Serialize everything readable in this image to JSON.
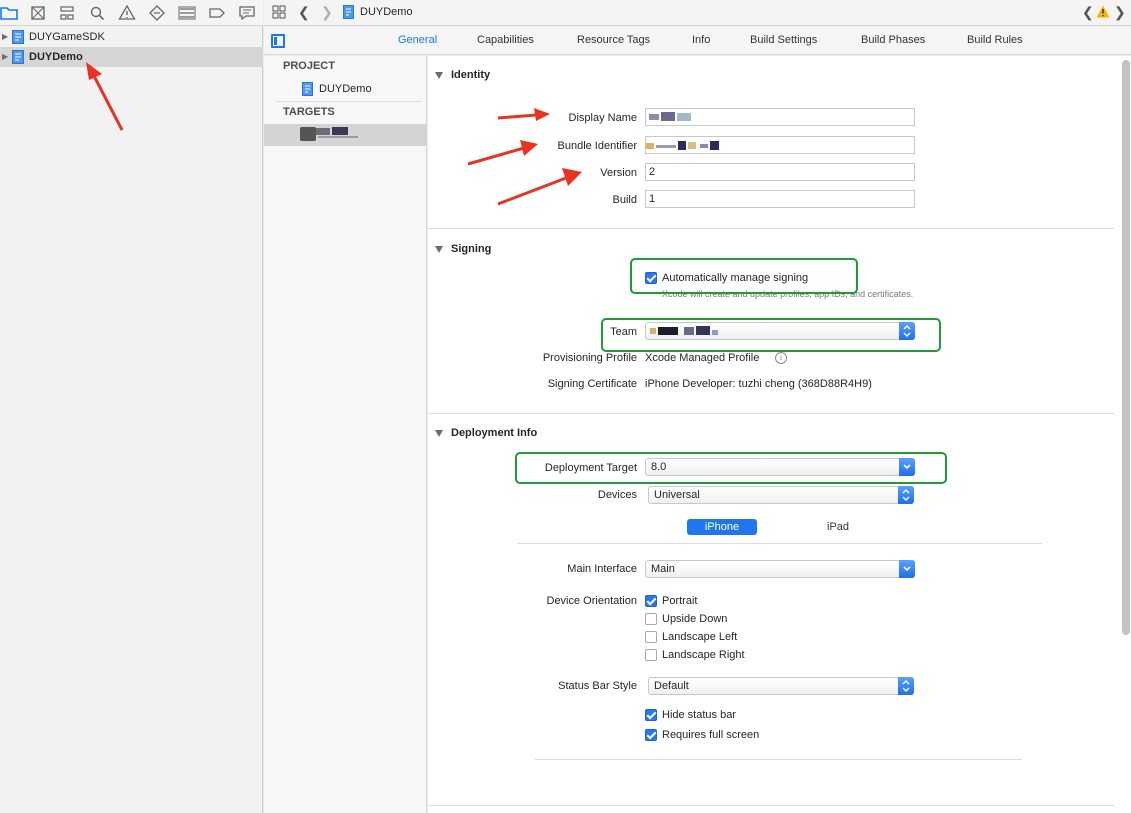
{
  "colors": {
    "accent": "#1c76f0",
    "highlight_box": "#1f9b3a",
    "annotation_arrow": "#e83323"
  },
  "navigator": {
    "toolbar_icons": [
      "folder-icon",
      "source-control-icon",
      "hierarchy-icon",
      "search-icon",
      "warning-icon",
      "test-icon",
      "debug-icon",
      "breakpoint-icon",
      "report-icon"
    ],
    "items": [
      {
        "label": "DUYGameSDK",
        "selected": false
      },
      {
        "label": "DUYDemo",
        "selected": true
      }
    ]
  },
  "jumpbar": {
    "breadcrumb": "DUYDemo"
  },
  "tabs": [
    "General",
    "Capabilities",
    "Resource Tags",
    "Info",
    "Build Settings",
    "Build Phases",
    "Build Rules"
  ],
  "targets_pane": {
    "project_header": "PROJECT",
    "project_item": "DUYDemo",
    "targets_header": "TARGETS"
  },
  "identity": {
    "title": "Identity",
    "display_name_label": "Display Name",
    "bundle_id_label": "Bundle Identifier",
    "version_label": "Version",
    "version_value": "2",
    "build_label": "Build",
    "build_value": "1"
  },
  "signing": {
    "title": "Signing",
    "auto_manage_label": "Automatically manage signing",
    "auto_manage_checked": true,
    "auto_manage_note": "Xcode will create and update profiles, app IDs, and certificates.",
    "team_label": "Team",
    "provisioning_label": "Provisioning Profile",
    "provisioning_value": "Xcode Managed Profile",
    "certificate_label": "Signing Certificate",
    "certificate_value": "iPhone Developer: tuzhi cheng (368D88R4H9)"
  },
  "deployment": {
    "title": "Deployment Info",
    "target_label": "Deployment Target",
    "target_value": "8.0",
    "devices_label": "Devices",
    "devices_value": "Universal",
    "seg_iphone": "iPhone",
    "seg_ipad": "iPad",
    "main_interface_label": "Main Interface",
    "main_interface_value": "Main",
    "orientation_label": "Device Orientation",
    "orientations": [
      {
        "label": "Portrait",
        "checked": true
      },
      {
        "label": "Upside Down",
        "checked": false
      },
      {
        "label": "Landscape Left",
        "checked": false
      },
      {
        "label": "Landscape Right",
        "checked": false
      }
    ],
    "status_bar_label": "Status Bar Style",
    "status_bar_value": "Default",
    "hide_status_bar": "Hide status bar",
    "requires_full_screen": "Requires full screen"
  }
}
